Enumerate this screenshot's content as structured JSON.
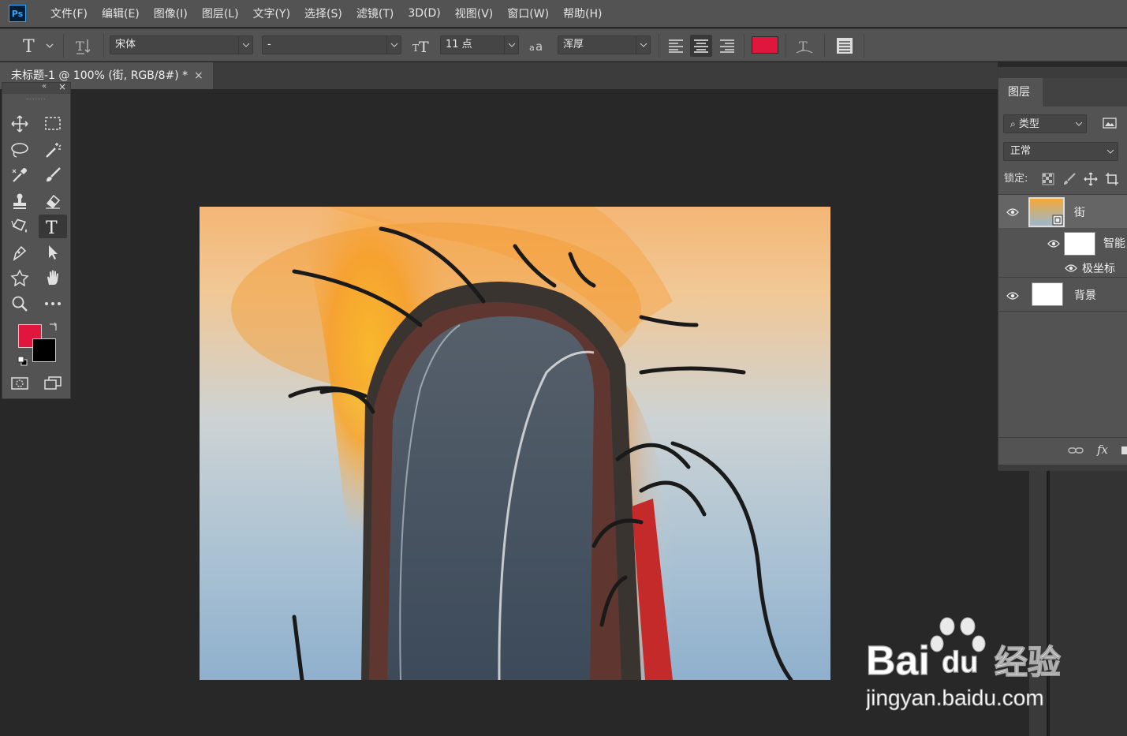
{
  "app": {
    "logo": "Ps"
  },
  "menu": [
    "文件(F)",
    "编辑(E)",
    "图像(I)",
    "图层(L)",
    "文字(Y)",
    "选择(S)",
    "滤镜(T)",
    "3D(D)",
    "视图(V)",
    "窗口(W)",
    "帮助(H)"
  ],
  "options": {
    "font_family": "宋体",
    "font_style": "-",
    "font_size": "11 点",
    "antialias": "浑厚",
    "color": "#e0163e"
  },
  "document": {
    "tab_title": "未标题-1 @ 100% (街, RGB/8#) *",
    "close": "×"
  },
  "tools": {
    "foreground": "#e0163e",
    "background": "#000000",
    "items": [
      "move-tool",
      "marquee-tool",
      "lasso-tool",
      "magic-wand-tool",
      "eyedropper-tool",
      "brush-tool",
      "stamp-tool",
      "eraser-tool",
      "paint-bucket-tool",
      "type-tool",
      "pen-tool",
      "path-selection-tool",
      "custom-shape-tool",
      "hand-tool",
      "zoom-tool",
      "more-tools"
    ]
  },
  "layers": {
    "tab": "图层",
    "filter_kind": "类型",
    "blend_mode": "正常",
    "lock_label": "锁定:",
    "items": [
      {
        "name": "街",
        "type": "smart-object",
        "selected": true
      },
      {
        "name": "智能",
        "type": "smart-filter-mask"
      },
      {
        "name": "极坐标",
        "type": "filter"
      },
      {
        "name": "背景",
        "type": "background"
      }
    ],
    "footer_fx": "fx"
  },
  "watermark": {
    "brand": "Bai",
    "suffix": "经验",
    "url": "jingyan.baidu.com"
  }
}
